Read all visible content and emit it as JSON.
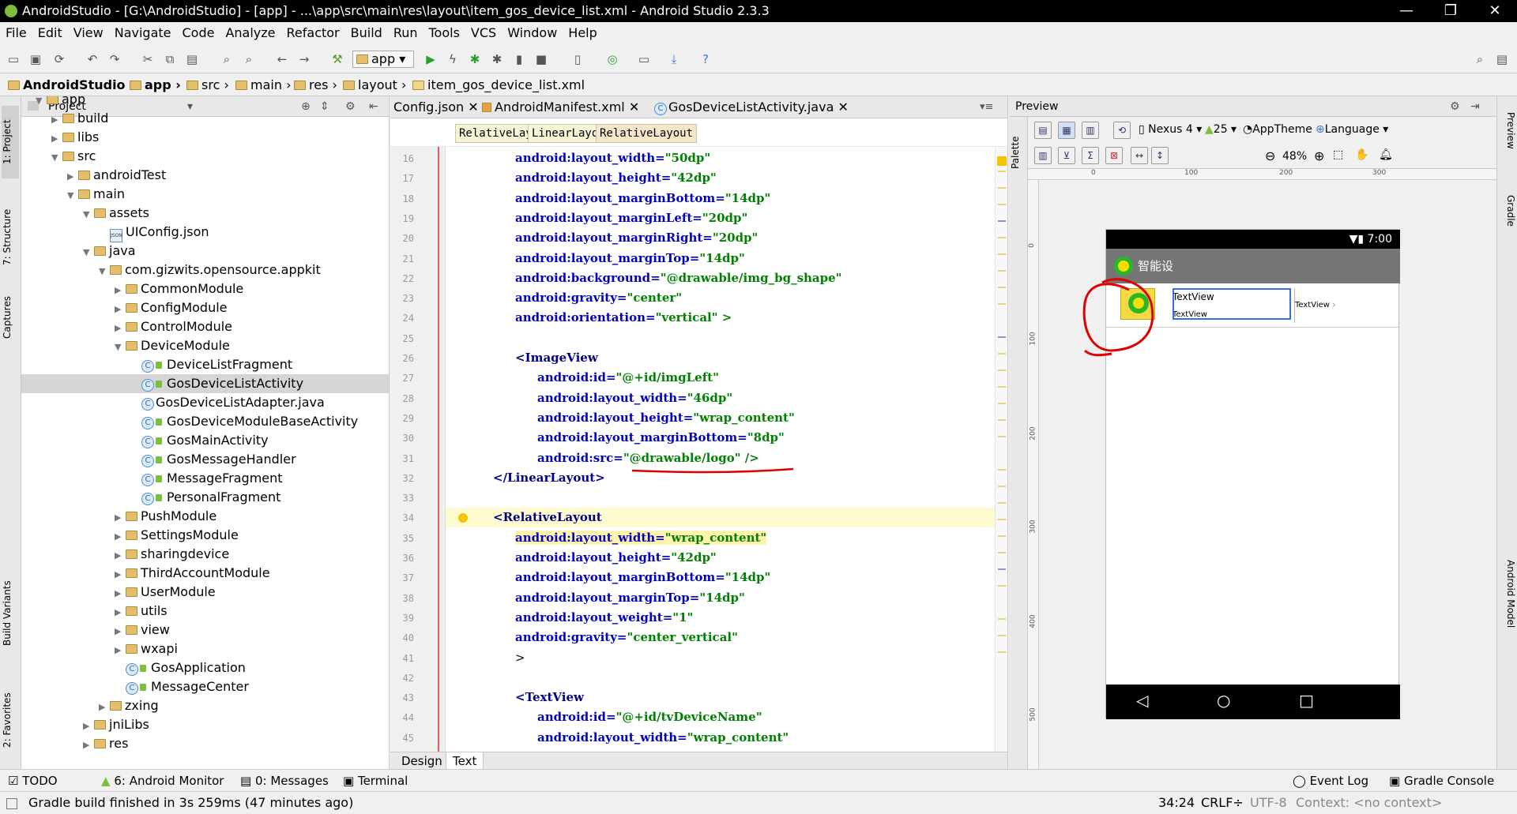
{
  "window": {
    "title": "AndroidStudio - [G:\\AndroidStudio] - [app] - ...\\app\\src\\main\\res\\layout\\item_gos_device_list.xml - Android Studio 2.3.3"
  },
  "menu": [
    "File",
    "Edit",
    "View",
    "Navigate",
    "Code",
    "Analyze",
    "Refactor",
    "Build",
    "Run",
    "Tools",
    "VCS",
    "Window",
    "Help"
  ],
  "toolbar": {
    "run_config": "app"
  },
  "breadcrumbs": [
    "AndroidStudio",
    "app",
    "src",
    "main",
    "res",
    "layout",
    "item_gos_device_list.xml"
  ],
  "left_tabs": [
    "1: Project",
    "7: Structure",
    "Captures",
    "Build Variants",
    "2: Favorites"
  ],
  "project": {
    "header": "Project",
    "tree": [
      {
        "label": "app",
        "depth": 1,
        "type": "folder"
      },
      {
        "label": "build",
        "depth": 2,
        "type": "folder"
      },
      {
        "label": "libs",
        "depth": 2,
        "type": "folder"
      },
      {
        "label": "src",
        "depth": 2,
        "type": "folder"
      },
      {
        "label": "androidTest",
        "depth": 3,
        "type": "folder"
      },
      {
        "label": "main",
        "depth": 3,
        "type": "folder"
      },
      {
        "label": "assets",
        "depth": 4,
        "type": "folder"
      },
      {
        "label": "UIConfig.json",
        "depth": 5,
        "type": "json"
      },
      {
        "label": "java",
        "depth": 4,
        "type": "folder"
      },
      {
        "label": "com.gizwits.opensource.appkit",
        "depth": 5,
        "type": "folder"
      },
      {
        "label": "CommonModule",
        "depth": 6,
        "type": "folder"
      },
      {
        "label": "ConfigModule",
        "depth": 6,
        "type": "folder"
      },
      {
        "label": "ControlModule",
        "depth": 6,
        "type": "folder"
      },
      {
        "label": "DeviceModule",
        "depth": 6,
        "type": "folder"
      },
      {
        "label": "DeviceListFragment",
        "depth": 7,
        "type": "class"
      },
      {
        "label": "GosDeviceListActivity",
        "depth": 7,
        "type": "class",
        "selected": true
      },
      {
        "label": "GosDeviceListAdapter.java",
        "depth": 7,
        "type": "java"
      },
      {
        "label": "GosDeviceModuleBaseActivity",
        "depth": 7,
        "type": "class"
      },
      {
        "label": "GosMainActivity",
        "depth": 7,
        "type": "class"
      },
      {
        "label": "GosMessageHandler",
        "depth": 7,
        "type": "class"
      },
      {
        "label": "MessageFragment",
        "depth": 7,
        "type": "class"
      },
      {
        "label": "PersonalFragment",
        "depth": 7,
        "type": "class"
      },
      {
        "label": "PushModule",
        "depth": 6,
        "type": "folder"
      },
      {
        "label": "SettingsModule",
        "depth": 6,
        "type": "folder"
      },
      {
        "label": "sharingdevice",
        "depth": 6,
        "type": "folder"
      },
      {
        "label": "ThirdAccountModule",
        "depth": 6,
        "type": "folder"
      },
      {
        "label": "UserModule",
        "depth": 6,
        "type": "folder"
      },
      {
        "label": "utils",
        "depth": 6,
        "type": "folder"
      },
      {
        "label": "view",
        "depth": 6,
        "type": "folder"
      },
      {
        "label": "wxapi",
        "depth": 6,
        "type": "folder"
      },
      {
        "label": "GosApplication",
        "depth": 6,
        "type": "class"
      },
      {
        "label": "MessageCenter",
        "depth": 6,
        "type": "class"
      },
      {
        "label": "zxing",
        "depth": 5,
        "type": "folder"
      },
      {
        "label": "jniLibs",
        "depth": 4,
        "type": "folder"
      },
      {
        "label": "res",
        "depth": 4,
        "type": "folder"
      }
    ]
  },
  "editor": {
    "tabs": [
      {
        "label": "Config.json",
        "active": false
      },
      {
        "label": "AndroidManifest.xml",
        "active": false
      },
      {
        "label": "GosDeviceListActivity.java",
        "active": false
      }
    ],
    "tag_path": [
      "RelativeLayout",
      "LinearLayout",
      "RelativeLayout"
    ],
    "lines": [
      {
        "n": "16",
        "indent": 6,
        "text": "android:layout_width=\"50dp\""
      },
      {
        "n": "17",
        "indent": 6,
        "text": "android:layout_height=\"42dp\""
      },
      {
        "n": "18",
        "indent": 6,
        "text": "android:layout_marginBottom=\"14dp\""
      },
      {
        "n": "19",
        "indent": 6,
        "text": "android:layout_marginLeft=\"20dp\""
      },
      {
        "n": "20",
        "indent": 6,
        "text": "android:layout_marginRight=\"20dp\""
      },
      {
        "n": "21",
        "indent": 6,
        "text": "android:layout_marginTop=\"14dp\""
      },
      {
        "n": "22",
        "indent": 6,
        "text": "android:background=\"@drawable/img_bg_shape\""
      },
      {
        "n": "23",
        "indent": 6,
        "text": "android:gravity=\"center\""
      },
      {
        "n": "24",
        "indent": 6,
        "text": "android:orientation=\"vertical\" >"
      },
      {
        "n": "25",
        "indent": 0,
        "text": ""
      },
      {
        "n": "26",
        "indent": 6,
        "text": "<ImageView"
      },
      {
        "n": "27",
        "indent": 8,
        "text": "android:id=\"@+id/imgLeft\""
      },
      {
        "n": "28",
        "indent": 8,
        "text": "android:layout_width=\"46dp\""
      },
      {
        "n": "29",
        "indent": 8,
        "text": "android:layout_height=\"wrap_content\""
      },
      {
        "n": "30",
        "indent": 8,
        "text": "android:layout_marginBottom=\"8dp\""
      },
      {
        "n": "31",
        "indent": 8,
        "text": "android:src=\"@drawable/logo\" />"
      },
      {
        "n": "32",
        "indent": 4,
        "text": "</LinearLayout>"
      },
      {
        "n": "33",
        "indent": 0,
        "text": ""
      },
      {
        "n": "34",
        "indent": 4,
        "text": "<RelativeLayout"
      },
      {
        "n": "35",
        "indent": 6,
        "text": "android:layout_width=\"wrap_content\""
      },
      {
        "n": "36",
        "indent": 6,
        "text": "android:layout_height=\"42dp\""
      },
      {
        "n": "37",
        "indent": 6,
        "text": "android:layout_marginBottom=\"14dp\""
      },
      {
        "n": "38",
        "indent": 6,
        "text": "android:layout_marginTop=\"14dp\""
      },
      {
        "n": "39",
        "indent": 6,
        "text": "android:layout_weight=\"1\""
      },
      {
        "n": "40",
        "indent": 6,
        "text": "android:gravity=\"center_vertical\""
      },
      {
        "n": "41",
        "indent": 6,
        "text": ">"
      },
      {
        "n": "42",
        "indent": 0,
        "text": ""
      },
      {
        "n": "43",
        "indent": 6,
        "text": "<TextView"
      },
      {
        "n": "44",
        "indent": 8,
        "text": "android:id=\"@+id/tvDeviceName\""
      },
      {
        "n": "45",
        "indent": 8,
        "text": "android:layout_width=\"wrap_content\""
      }
    ],
    "bottom_tabs": [
      "Design",
      "Text"
    ]
  },
  "preview": {
    "header": "Preview",
    "palette_label": "Palette",
    "device": "Nexus 4",
    "api": "25",
    "theme": "AppTheme",
    "language": "Language",
    "zoom": "48%",
    "ruler_x": [
      "0",
      "100",
      "200",
      "300"
    ],
    "ruler_y": [
      "0",
      "100",
      "200",
      "300",
      "400",
      "500"
    ],
    "phone": {
      "time": "7:00",
      "app_title": "智能设",
      "text1": "TextView",
      "text2": "TextView",
      "text3": "TextView"
    }
  },
  "right_tabs": [
    "Preview",
    "Gradle",
    "Android Model"
  ],
  "bottom_tools": [
    "TODO",
    "6: Android Monitor",
    "0: Messages",
    "Terminal",
    "Event Log",
    "Gradle Console"
  ],
  "status": {
    "message": "Gradle build finished in 3s 259ms (47 minutes ago)",
    "position": "34:24",
    "line_sep": "CRLF÷",
    "encoding": "UTF-8",
    "context": "Context: <no context>"
  },
  "colors": {
    "accent": "#4a8fd0",
    "annotation": "#e00000",
    "folder": "#e3bf6c"
  }
}
